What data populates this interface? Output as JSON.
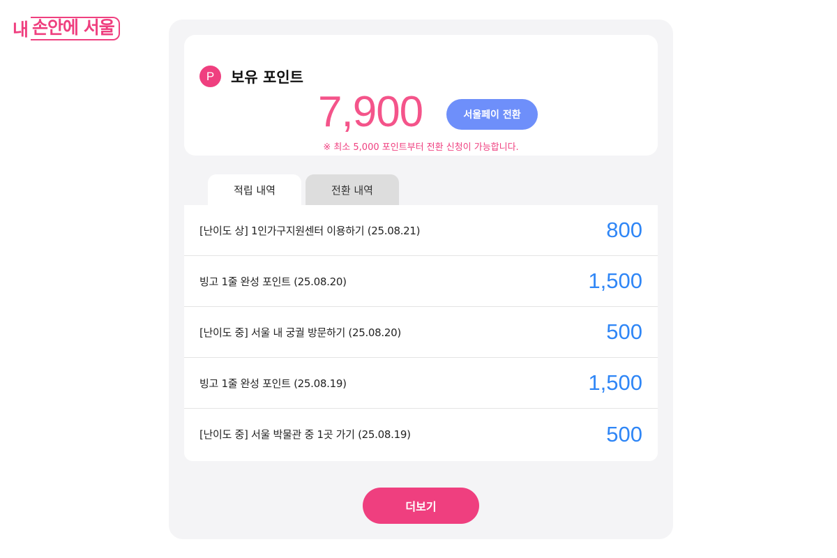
{
  "logo": {
    "prefix": "내",
    "boxed": "손안에 서울"
  },
  "summary": {
    "icon_letter": "P",
    "title": "보유 포인트",
    "points": "7,900",
    "convert_button": "서울페이 전환",
    "notice": "※ 최소 5,000 포인트부터 전환 신청이 가능합니다."
  },
  "tabs": [
    {
      "label": "적립 내역",
      "active": true
    },
    {
      "label": "전환 내역",
      "active": false
    }
  ],
  "history": [
    {
      "label": "[난이도 상] 1인가구지원센터 이용하기 (25.08.21)",
      "points": "800"
    },
    {
      "label": "빙고 1줄 완성 포인트 (25.08.20)",
      "points": "1,500"
    },
    {
      "label": "[난이도 중] 서울 내 궁궐 방문하기 (25.08.20)",
      "points": "500"
    },
    {
      "label": "빙고 1줄 완성 포인트 (25.08.19)",
      "points": "1,500"
    },
    {
      "label": "[난이도 중] 서울 박물관 중 1곳 가기 (25.08.19)",
      "points": "500"
    }
  ],
  "more_button": "더보기",
  "colors": {
    "accent": "#ef3f7f",
    "points_pink": "#f4548a",
    "convert_blue": "#6e8ffa",
    "history_blue": "#2f86f6"
  }
}
